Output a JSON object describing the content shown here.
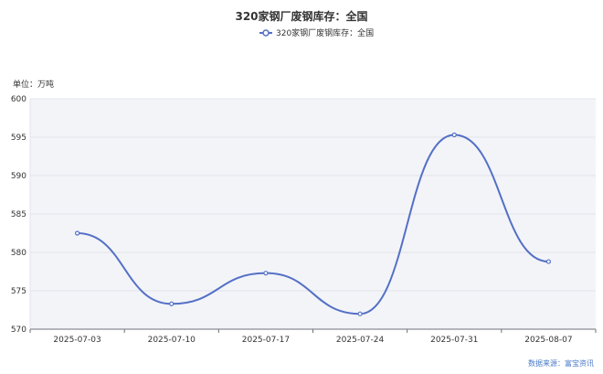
{
  "chart_data": {
    "type": "line",
    "title": "320家钢厂废钢库存：全国",
    "unit_label": "单位：万吨",
    "source": "数据来源：富宝资讯",
    "categories": [
      "2025-07-03",
      "2025-07-10",
      "2025-07-17",
      "2025-07-24",
      "2025-07-31",
      "2025-08-07"
    ],
    "series": [
      {
        "name": "320家钢厂废钢库存：全国",
        "values": [
          582.5,
          573.3,
          577.3,
          572.0,
          595.3,
          578.8
        ],
        "color": "#5470c6"
      }
    ],
    "ylim": [
      570,
      600
    ],
    "yticks": [
      570,
      575,
      580,
      585,
      590,
      595,
      600
    ],
    "grid": true,
    "smooth": true,
    "legend_position": "top-center"
  },
  "colors": {
    "plot_bg": "#f3f4f8",
    "grid": "#e2e4ea",
    "axis": "#6e7079",
    "line": "#5470c6"
  }
}
